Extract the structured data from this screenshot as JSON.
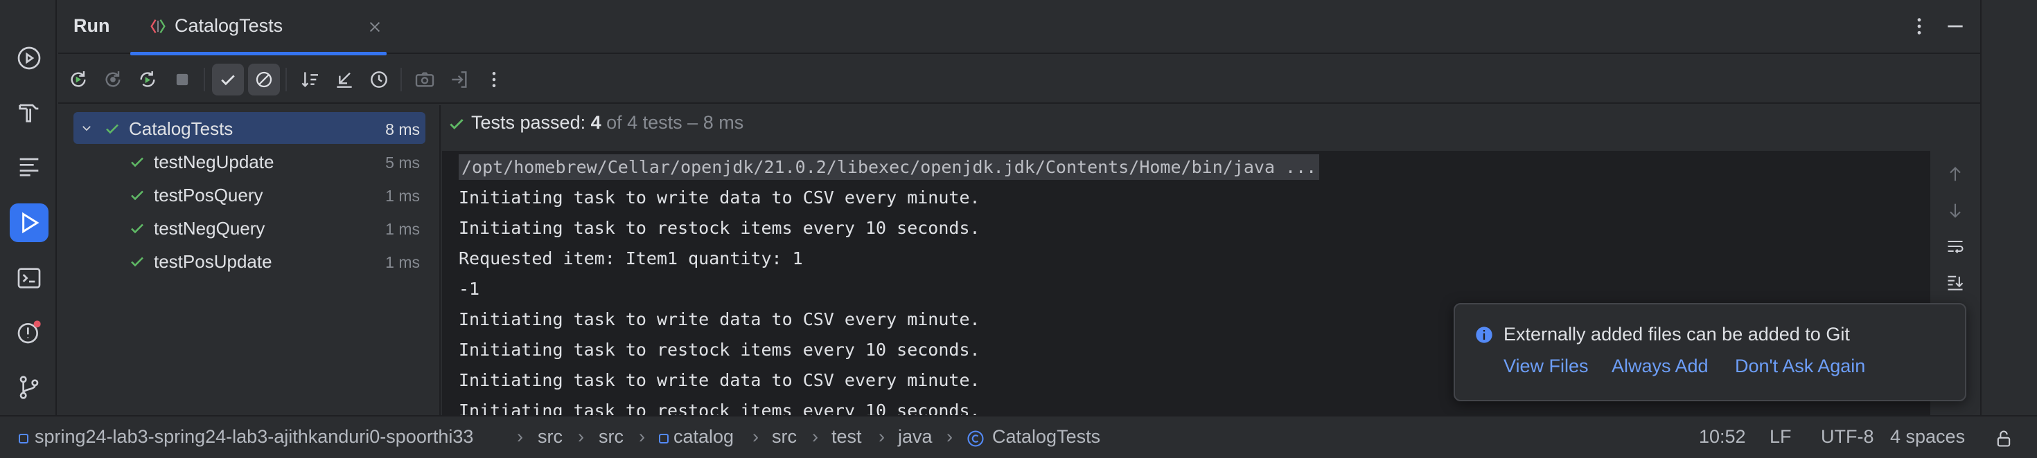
{
  "tool_window": {
    "title": "Run",
    "tab": {
      "title": "CatalogTests",
      "close_icon": "close-icon",
      "icon": "junit-test-icon"
    }
  },
  "left_toolbar": {
    "items": [
      {
        "name": "services-icon"
      },
      {
        "name": "build-hammer-icon"
      },
      {
        "name": "structure-icon"
      },
      {
        "name": "run-icon",
        "active": true
      },
      {
        "name": "terminal-icon"
      },
      {
        "name": "problems-icon"
      },
      {
        "name": "git-icon"
      }
    ]
  },
  "run_toolbar": {
    "buttons": [
      "rerun-icon",
      "rerun-failed-icon",
      "toggle-auto-test-icon",
      "stop-icon",
      "show-passed-icon",
      "show-ignored-icon",
      "sort-icon",
      "collapse-icon",
      "history-icon",
      "screenshot-icon",
      "export-icon",
      "more-icon"
    ]
  },
  "test_tree": {
    "root": {
      "name": "CatalogTests",
      "time": "8 ms",
      "status": "passed"
    },
    "children": [
      {
        "name": "testNegUpdate",
        "time": "5 ms",
        "status": "passed"
      },
      {
        "name": "testPosQuery",
        "time": "1 ms",
        "status": "passed"
      },
      {
        "name": "testNegQuery",
        "time": "1 ms",
        "status": "passed"
      },
      {
        "name": "testPosUpdate",
        "time": "1 ms",
        "status": "passed"
      }
    ]
  },
  "console": {
    "status_prefix": "Tests passed: ",
    "status_count": "4",
    "status_suffix": " of 4 tests – 8 ms",
    "lines": [
      "/opt/homebrew/Cellar/openjdk/21.0.2/libexec/openjdk.jdk/Contents/Home/bin/java ...",
      "Initiating task to write data to CSV every minute.",
      "Initiating task to restock items every 10 seconds.",
      "Requested item: Item1 quantity: 1",
      "-1",
      "Initiating task to write data to CSV every minute.",
      "Initiating task to restock items every 10 seconds.",
      "Initiating task to write data to CSV every minute.",
      "Initiating task to restock items every 10 seconds."
    ]
  },
  "notification": {
    "message": "Externally added files can be added to Git",
    "actions": [
      "View Files",
      "Always Add",
      "Don't Ask Again"
    ]
  },
  "status_bar": {
    "breadcrumbs": [
      "spring24-lab3-spring24-lab3-ajithkanduri0-spoorthi33",
      "src",
      "src",
      "catalog",
      "src",
      "test",
      "java",
      "CatalogTests"
    ],
    "caret": "10:52",
    "line_separator": "LF",
    "encoding": "UTF-8",
    "indent": "4 spaces"
  },
  "colors": {
    "accent": "#3574f0",
    "passed": "#5fb865",
    "link": "#6d9ef8",
    "background": "#2b2d30",
    "console_bg": "#1e1f22"
  }
}
